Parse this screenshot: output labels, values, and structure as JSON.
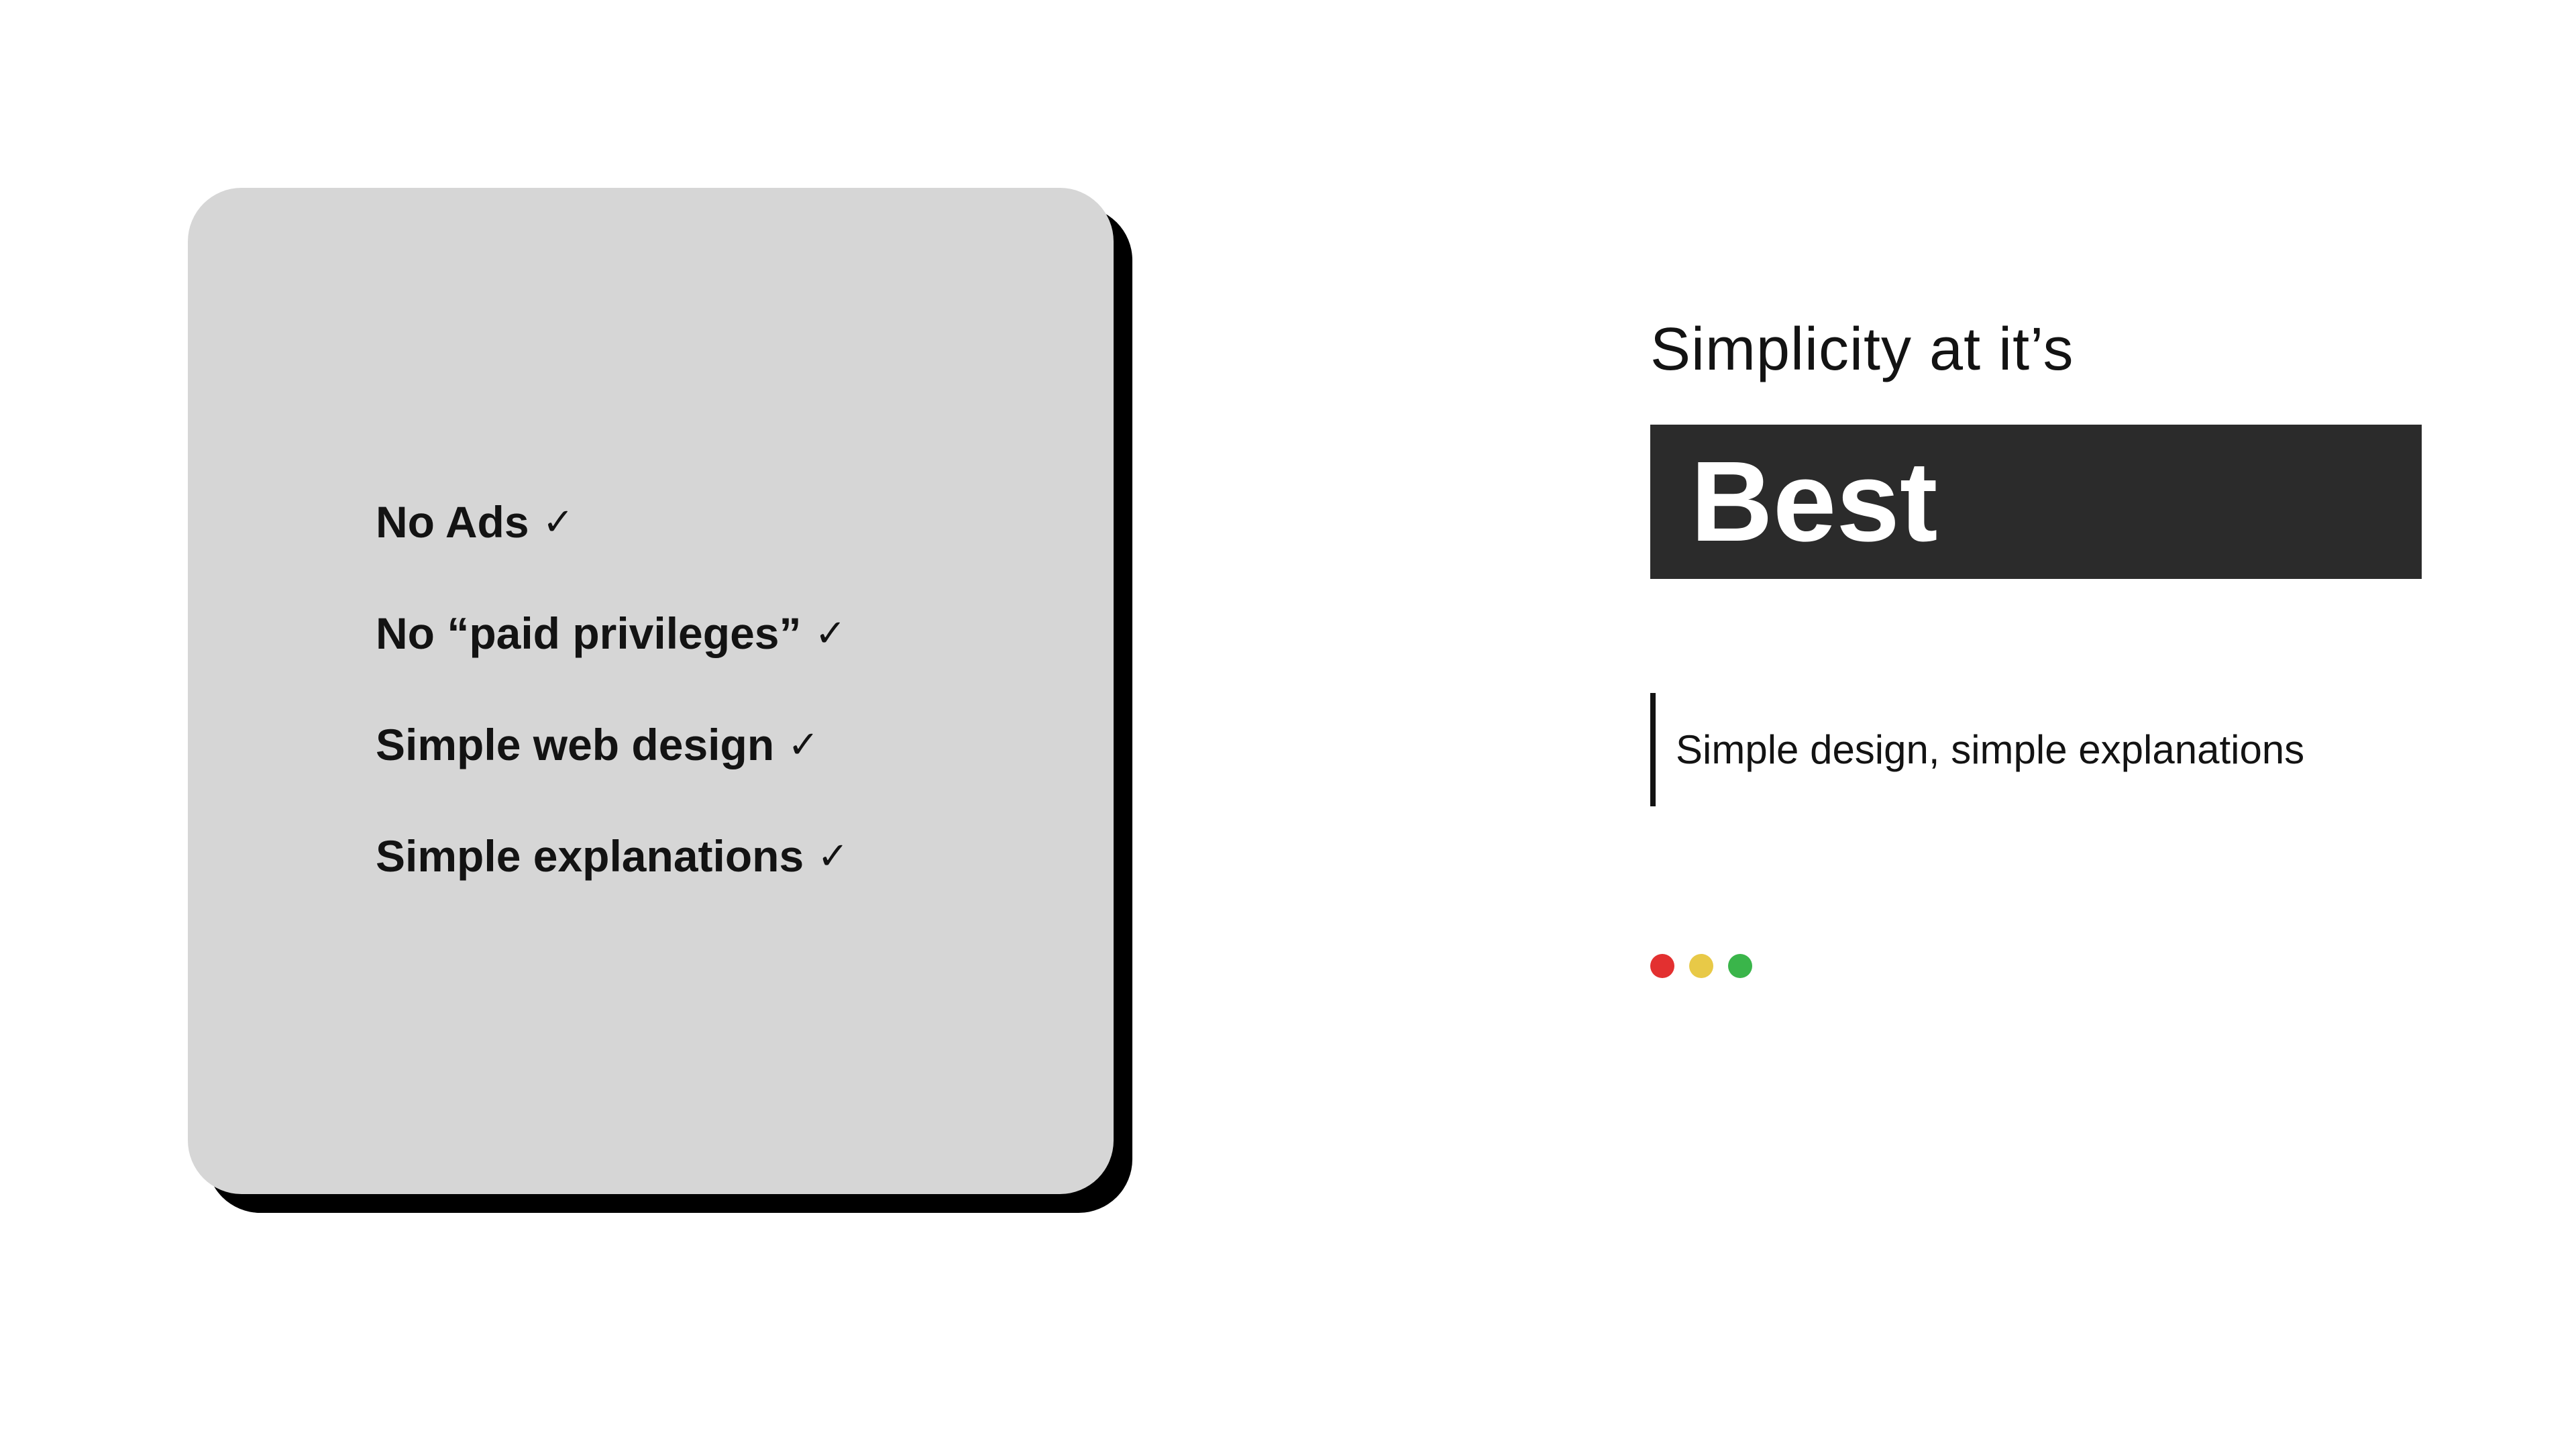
{
  "features": {
    "items": [
      {
        "label": "No Ads"
      },
      {
        "label": "No “paid privileges”"
      },
      {
        "label": "Simple web design"
      },
      {
        "label": "Simple explanations"
      }
    ],
    "check": "✓"
  },
  "heading": {
    "pre": "Simplicity at it’s",
    "highlight": "Best"
  },
  "tagline": "Simple design, simple explanations",
  "colors": {
    "card_bg": "#d6d6d6",
    "highlight_bg": "#2b2b2b",
    "dot_red": "#e33030",
    "dot_yellow": "#e8c947",
    "dot_green": "#3ab54a"
  }
}
